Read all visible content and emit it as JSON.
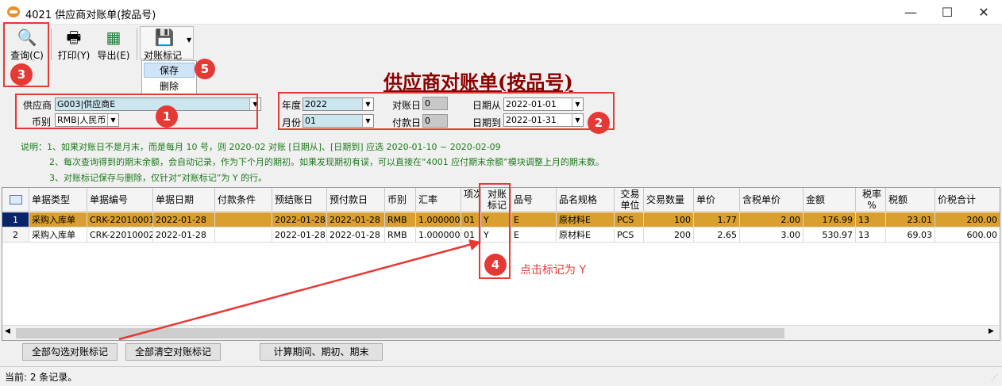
{
  "window": {
    "title": "4021 供应商对账单(按品号)",
    "minimize": "—",
    "maximize": "☐",
    "close": "✕"
  },
  "toolbar": {
    "query_label": "查询(C)",
    "print_label": "打印(Y)",
    "export_label": "导出(E)",
    "reconcile_label": "对账标记",
    "menu_save": "保存",
    "menu_delete": "删除"
  },
  "report_title": "供应商对账单(按品号)",
  "form": {
    "supplier_label": "供应商",
    "supplier_value": "G003|供应商E",
    "currency_label": "币别",
    "currency_value": "RMB|人民币",
    "year_label": "年度",
    "year_value": "2022",
    "month_label": "月份",
    "month_value": "01",
    "recon_day_label": "对账日",
    "recon_day_value": "0",
    "pay_day_label": "付款日",
    "pay_day_value": "0",
    "date_from_label": "日期从",
    "date_from_value": "2022-01-01",
    "date_to_label": "日期到",
    "date_to_value": "2022-01-31"
  },
  "notes": [
    "说明：1、如果对账日不是月末，而是每月 10 号，则 2020-02 对账 [日期从]、[日期到] 应选 2020-01-10 ~ 2020-02-09",
    "2、每次查询得到的期末余额，会自动记录，作为下个月的期初。如果发现期初有误，可以直接在“4001 应付期末余额”模块调整上月的期末数。",
    "3、对账标记保存与删除，仅针对“对账标记”为 Y 的行。"
  ],
  "grid": {
    "headers": [
      "",
      "单据类型",
      "单据编号",
      "单据日期",
      "付款条件",
      "预结账日",
      "预付款日",
      "币别",
      "汇率",
      "项次",
      "对账标记",
      "品号",
      "品名规格",
      "交易单位",
      "交易数量",
      "单价",
      "含税单价",
      "金额",
      "税率%",
      "税额",
      "价税合计"
    ],
    "rows": [
      [
        "1",
        "采购入库单",
        "CRK-22010001",
        "2022-01-28",
        "",
        "2022-01-28",
        "2022-01-28",
        "RMB",
        "1.000000",
        "01",
        "Y",
        "E",
        "原材料E",
        "PCS",
        "100",
        "1.77",
        "2.00",
        "176.99",
        "13",
        "23.01",
        "200.00"
      ],
      [
        "2",
        "采购入库单",
        "CRK-22010002",
        "2022-01-28",
        "",
        "2022-01-28",
        "2022-01-28",
        "RMB",
        "1.000000",
        "01",
        "Y",
        "E",
        "原材料E",
        "PCS",
        "200",
        "2.65",
        "3.00",
        "530.97",
        "13",
        "69.03",
        "600.00"
      ]
    ]
  },
  "buttons": {
    "check_all": "全部勾选对账标记",
    "clear_all": "全部清空对账标记",
    "calc": "计算期间、期初、期末"
  },
  "status": "当前: 2 条记录。",
  "annotations": {
    "b1": "1",
    "b2": "2",
    "b3": "3",
    "b4": "4",
    "b5": "5",
    "hint": "点击标记为 Y",
    "color": "#e53935"
  }
}
